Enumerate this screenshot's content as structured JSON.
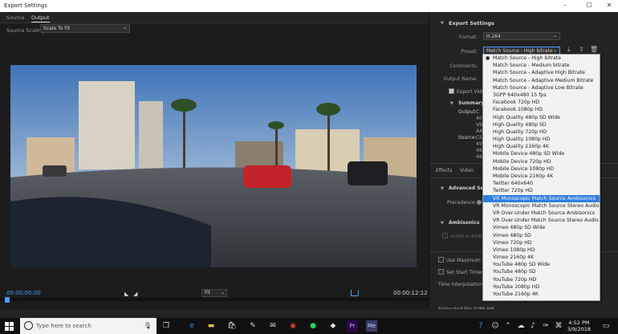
{
  "window": {
    "title": "Export Settings",
    "minimize": "–",
    "maximize": "☐",
    "close": "✕"
  },
  "source_tabs": [
    "Source",
    "Output"
  ],
  "scaling": {
    "label": "Source Scaling:",
    "value": "Scale To Fit"
  },
  "player": {
    "timecode_in": "00:00:00:00",
    "timecode_out": "00:00:12:12",
    "zoom": "Fit",
    "mark_in": "◣",
    "mark_out": "◢"
  },
  "export": {
    "header": "Export Settings",
    "format_label": "Format:",
    "format_value": "H.264",
    "preset_label": "Preset:",
    "preset_value": "Match Source - High bitrate",
    "comments_label": "Comments:",
    "output_name_label": "Output Name:",
    "export_video_label": "Export Video",
    "summary_header": "Summary",
    "output_label": "Output:",
    "output_lines": [
      "C",
      "40",
      "VB",
      "AA"
    ],
    "source_label": "Source:",
    "source_lines": [
      "Cli",
      "49",
      "48",
      "48"
    ],
    "tabs": [
      "Effects",
      "Video"
    ],
    "advanced_header": "Advanced Settings",
    "precedence_label": "Precedence:",
    "ambisonics_header": "Ambisonics",
    "audio_ambisonics_label": "Audio is Ambiso",
    "use_max_render": "Use Maximum Rend",
    "set_start_timecode": "Set Start Timecode",
    "time_interp_label": "Time Interpolation:",
    "est_file_size_label": "Estimated File Size:",
    "est_file_size_value": "15 MB"
  },
  "preset_options": [
    "Match Source - High bitrate",
    "Match Source - Medium bitrate",
    "Match Source - Adaptive High Bitrate",
    "Match Source - Adaptive Medium Bitrate",
    "Match Source - Adaptive Low Bitrate",
    "3GPP 640x480 15 fps",
    "Facebook 720p HD",
    "Facebook 1080p HD",
    "High Quality 480p SD Wide",
    "High Quality 480p SD",
    "High Quality 720p HD",
    "High Quality 1080p HD",
    "High Quality 2160p 4K",
    "Mobile Device 480p SD Wide",
    "Mobile Device 720p HD",
    "Mobile Device 1080p HD",
    "Mobile Device 2160p 4K",
    "Twitter 640x640",
    "Twitter 720p HD",
    "VR Monoscopic Match Source Ambisonics",
    "VR Monoscopic Match Source Stereo Audio",
    "VR Over-Under Match Source Ambisonics",
    "VR Over-Under Match Source Stereo Audio",
    "Vimeo 480p SD Wide",
    "Vimeo 480p SD",
    "Vimeo 720p HD",
    "Vimeo 1080p HD",
    "Vimeo 2160p 4K",
    "YouTube 480p SD Wide",
    "YouTube 480p SD",
    "YouTube 720p HD",
    "YouTube 1080p HD",
    "YouTube 2160p 4K"
  ],
  "preset_checked_index": 0,
  "preset_highlighted_index": 19,
  "taskbar": {
    "search_placeholder": "Type here to search",
    "time": "4:52 PM",
    "date": "3/9/2018"
  },
  "colors": {
    "accent": "#4a9bff",
    "highlight": "#2f7fe0",
    "panel": "#232323"
  }
}
